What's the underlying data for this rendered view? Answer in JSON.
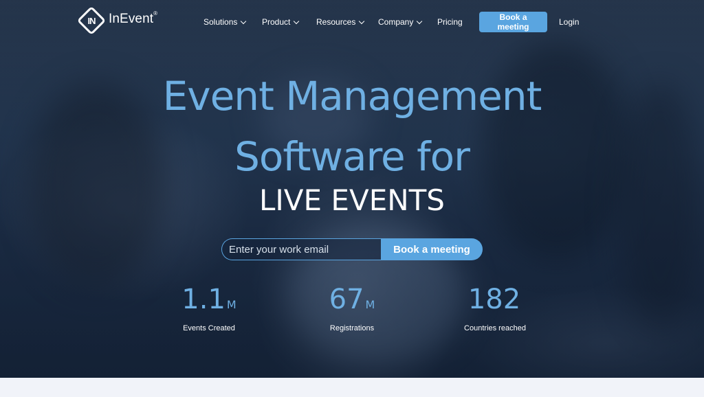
{
  "brand": {
    "name": "InEvent",
    "mark": "IN",
    "registered": "®"
  },
  "nav": {
    "items": [
      {
        "label": "Solutions",
        "dropdown": true
      },
      {
        "label": "Product",
        "dropdown": true
      },
      {
        "label": "Resources",
        "dropdown": true
      },
      {
        "label": "Company",
        "dropdown": true
      },
      {
        "label": "Pricing",
        "dropdown": false
      }
    ],
    "cta_label": "Book a meeting",
    "login_label": "Login"
  },
  "hero": {
    "line1": "Event Management",
    "line2": "Software for",
    "line3": "LIVE EVENTS",
    "email_placeholder": "Enter your work email",
    "submit_label": "Book a meeting"
  },
  "stats": [
    {
      "value": "1.1",
      "unit": "M",
      "label": "Events Created"
    },
    {
      "value": "67",
      "unit": "M",
      "label": "Registrations"
    },
    {
      "value": "182",
      "unit": "",
      "label": "Countries reached"
    }
  ],
  "colors": {
    "accent": "#5aa5e0",
    "headline": "#6fb0e3",
    "background": "#22344d"
  }
}
